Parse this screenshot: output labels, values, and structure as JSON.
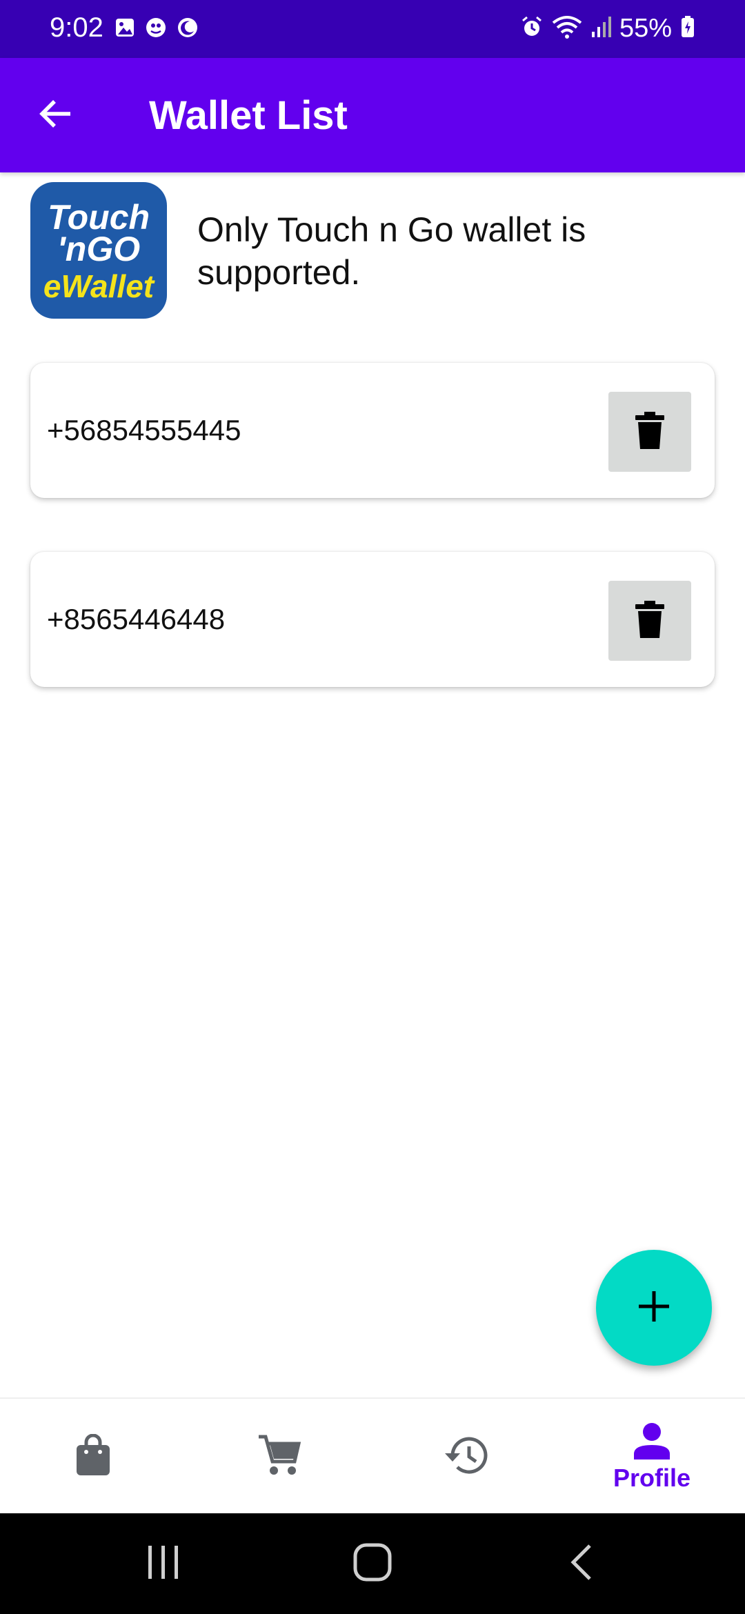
{
  "status_bar": {
    "time": "9:02",
    "battery": "55%",
    "left_icons": [
      "image-icon",
      "app-notification-icon",
      "moon-icon"
    ],
    "right_icons": [
      "alarm-icon",
      "wifi-icon",
      "signal-icon",
      "battery-icon"
    ]
  },
  "app_bar": {
    "title": "Wallet List",
    "back_icon": "arrow-back-icon",
    "color": "#6200ee"
  },
  "info": {
    "logo_lines": [
      "Touch",
      "'nGO",
      "eWallet"
    ],
    "text": "Only Touch n Go wallet is supported."
  },
  "wallets": [
    {
      "number": "+56854555445",
      "action_icon": "trash-icon"
    },
    {
      "number": "+8565446448",
      "action_icon": "trash-icon"
    }
  ],
  "fab": {
    "icon": "plus-icon",
    "color": "#03dac5"
  },
  "bottom_nav": {
    "items": [
      {
        "icon": "shopping-bag-icon",
        "label": ""
      },
      {
        "icon": "cart-icon",
        "label": ""
      },
      {
        "icon": "history-icon",
        "label": ""
      },
      {
        "icon": "person-icon",
        "label": "Profile",
        "selected": true
      }
    ]
  },
  "system_nav": {
    "icons": [
      "recents-icon",
      "home-icon",
      "back-icon"
    ]
  }
}
